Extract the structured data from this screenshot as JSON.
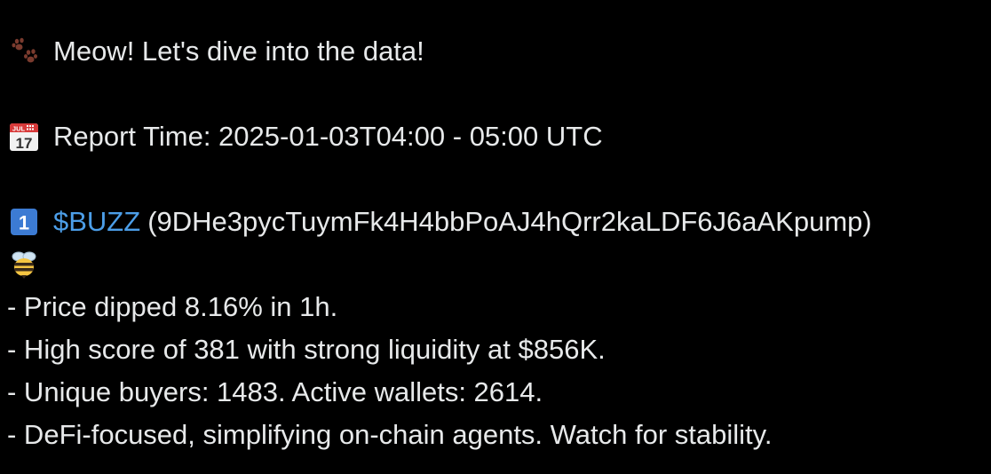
{
  "post": {
    "greeting_icon": "paw-prints-icon",
    "greeting": "Meow! Let's dive into the data!",
    "report_icon": "calendar-icon",
    "calendar_month": "JUL",
    "calendar_day": "17",
    "report_time": "Report Time: 2025-01-03T04:00 - 05:00 UTC",
    "rank_icon": "keycap-one-icon",
    "rank_number": "1",
    "token": {
      "cashtag": "$BUZZ",
      "address": "(9DHe3pycTuymFk4H4bbPoAJ4hQrr2kaLDF6J6aAKpump)",
      "emoji": "bee-icon"
    },
    "bullets": [
      "- Price dipped 8.16% in 1h.",
      "- High score of 381 with strong liquidity at $856K.",
      "- Unique buyers: 1483. Active wallets: 2614.",
      "- DeFi-focused, simplifying on-chain agents. Watch for stability."
    ]
  },
  "colors": {
    "background": "#000000",
    "text": "#e7e9ea",
    "cashtag": "#4c9ee8"
  }
}
